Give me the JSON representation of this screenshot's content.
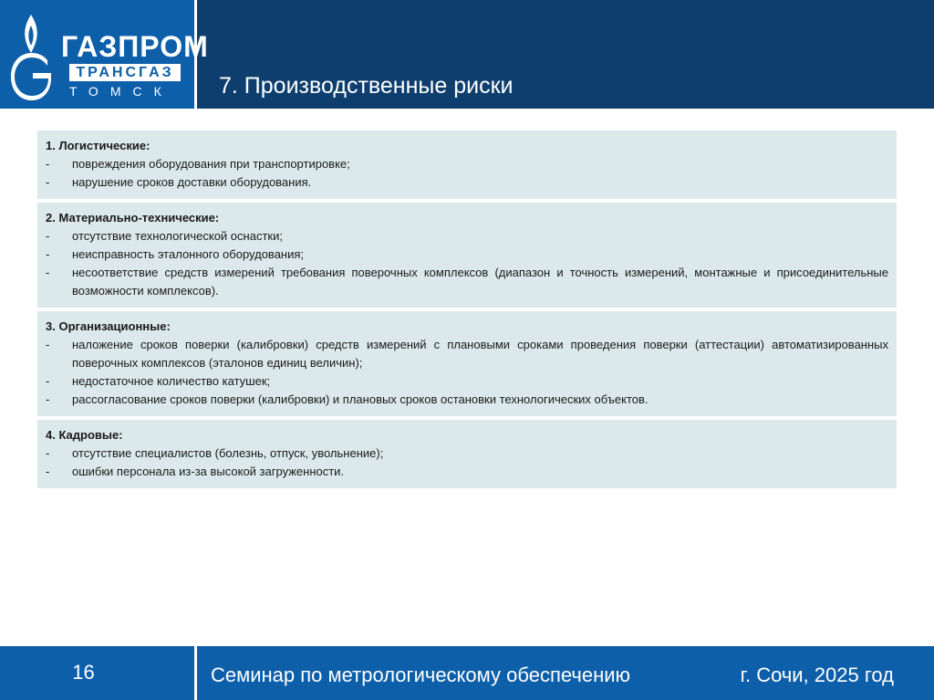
{
  "logo": {
    "line1": "ГАЗПРОМ",
    "line2": "ТРАНСГАЗ",
    "line3": "ТОМСК",
    "icon": "gazprom-flame-logo"
  },
  "slide": {
    "title": "7. Производственные риски"
  },
  "sections": [
    {
      "title": "1. Логистические:",
      "items": [
        "повреждения оборудования при транспортировке;",
        "нарушение сроков доставки оборудования."
      ]
    },
    {
      "title": "2. Материально-технические:",
      "items": [
        "отсутствие технологической оснастки;",
        "неисправность эталонного оборудования;",
        "несоответствие средств измерений требования поверочных комплексов (диапазон и точность измерений, монтажные и присоединительные возможности комплексов)."
      ]
    },
    {
      "title": "3. Организационные:",
      "items": [
        "наложение сроков поверки (калибровки) средств измерений с плановыми сроками проведения поверки (аттестации) автоматизированных поверочных комплексов (эталонов единиц величин);",
        "недостаточное количество катушек;",
        "рассогласование сроков поверки (калибровки) и плановых сроков остановки технологических объектов."
      ]
    },
    {
      "title": "4. Кадровые:",
      "items": [
        "отсутствие специалистов (болезнь, отпуск, увольнение);",
        "ошибки персонала из-за высокой загруженности."
      ]
    }
  ],
  "bullet": "-",
  "footer": {
    "page": "16",
    "seminar": "Семинар по метрологическому обеспечению",
    "location": "г. Сочи, 2025 год"
  },
  "colors": {
    "header": "#0d3e6e",
    "brand_blue": "#0d5faa",
    "section_bg": "#dce9ea"
  }
}
